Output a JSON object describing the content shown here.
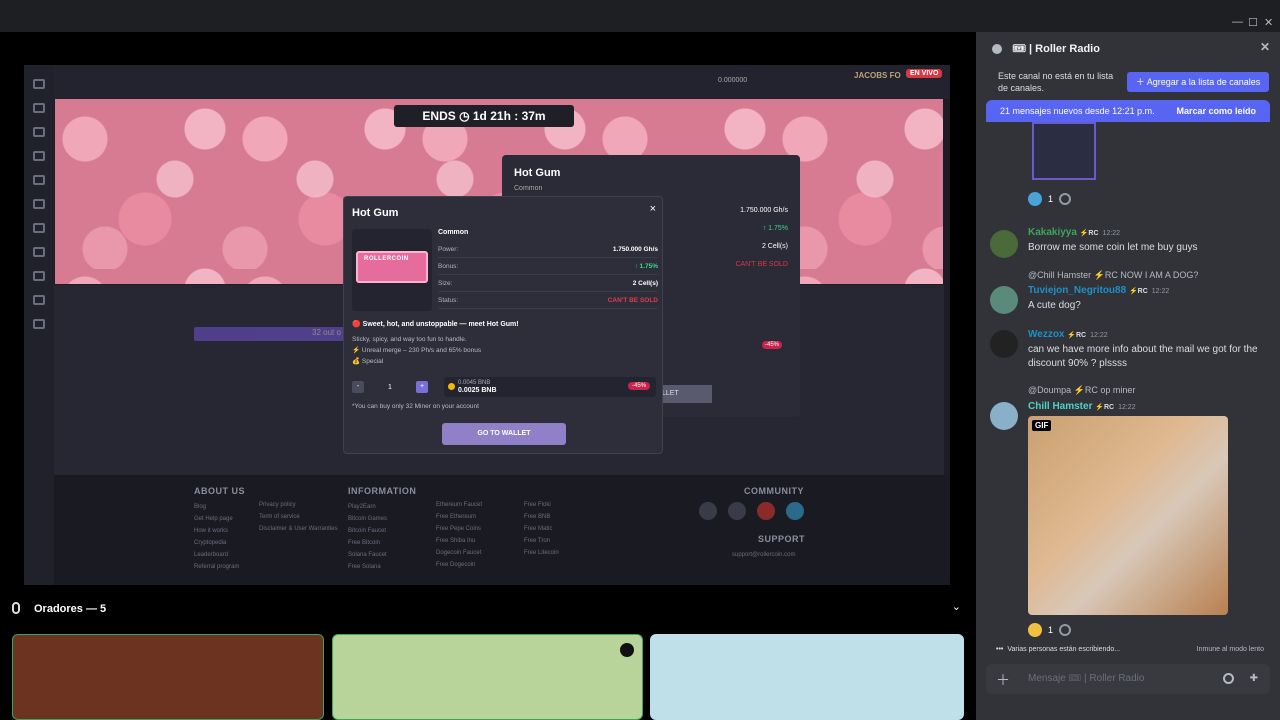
{
  "stream": {
    "ends_label": "ENDS ◷ 1d 21h : 37m",
    "balance": "0.000000",
    "username": "JACOBS FO",
    "live_badge": "EN VIVO",
    "bg_panel_title": "Hot Gum",
    "bg_panel_common": "Common",
    "bg_power": "1.750.000 Gh/s",
    "bg_bonus": "↑ 1.75%",
    "bg_size": "2 Cell(s)",
    "bg_status": "CAN'T BE SOLD",
    "bg_disc": "-45%",
    "bg_wallet": "LLET",
    "progress_text": "32 out o"
  },
  "modal": {
    "title": "Hot Gum",
    "close": "×",
    "rarity": "Common",
    "chip_label": "ROLLERCOIN",
    "rows": [
      {
        "label": "Power:",
        "value": "1.750.000 Gh/s"
      },
      {
        "label": "Bonus:",
        "value": "↑ 1.75%"
      },
      {
        "label": "Size:",
        "value": "2 Cell(s)"
      },
      {
        "label": "Status:",
        "value": "CAN'T BE SOLD"
      }
    ],
    "lead": "🔴 Sweet, hot, and unstoppable — meet Hot Gum!",
    "line1": "Sticky, spicy, and way too fun to handle.",
    "line2": "⚡ Unreal merge – 230 Ph/s and 65% bonus",
    "line3": "💰 Special",
    "qty_minus": "-",
    "qty_value": "1",
    "qty_plus": "+",
    "price_old": "0.0045 BNB",
    "price_new": "0.0025 BNB",
    "discount": "-45%",
    "note": "*You can buy only 32 Miner on your account",
    "button": "GO TO WALLET"
  },
  "footer": {
    "about": {
      "head": "ABOUT US",
      "items": [
        "Blog",
        "Get Help page",
        "How it works",
        "Cryptopedia",
        "Leaderboard",
        "Referral program"
      ]
    },
    "about2": {
      "items": [
        "Privacy policy",
        "Term of service",
        "Disclaimer & User Warranties"
      ]
    },
    "info": {
      "head": "INFORMATION",
      "items": [
        "Play2Earn",
        "Bitcoin Games",
        "Bitcoin Faucet",
        "Free Bitcoin",
        "Solana Faucet",
        "Free Solana"
      ]
    },
    "info2": {
      "items": [
        "Ethereum Faucet",
        "Free Ethereum",
        "Free Pepe Coins",
        "Free Shiba Inu",
        "Dogecoin Faucet",
        "Free Dogecoin"
      ]
    },
    "info3": {
      "items": [
        "Free Floki",
        "Free BNB",
        "Free Matic",
        "Free Tron",
        "Free Litecoin"
      ]
    },
    "community": "COMMUNITY",
    "support": "SUPPORT",
    "support_email": "support@rollercoin.com"
  },
  "speakers": {
    "label": "Oradores — 5"
  },
  "chat": {
    "channel": "🎟 | Roller Radio",
    "not_in_list": "Este canal no está en tu lista de canales.",
    "add_button": "＋ Agregar a la lista de canales",
    "new_messages": "21 mensajes nuevos desde 12:21 p.m.",
    "mark_read": "Marcar como leído",
    "messages": [
      {
        "user": "Kakakiyya",
        "tag": "⚡RC",
        "time": "12:22",
        "text": "Borrow me some coin let me buy guys",
        "color": "#3ba55d"
      },
      {
        "reply": "@Chill Hamster ⚡RC NOW I AM A DOG?",
        "user": "Tuviejon_Negritou88",
        "tag": "⚡RC",
        "time": "12:22",
        "text": "A cute dog?",
        "color": "#1e90c8"
      },
      {
        "user": "Wezzox",
        "tag": "⚡RC",
        "time": "12:22",
        "text": "can we have more info about the mail we got  for the discount 90% ? plssss",
        "color": "#1e90c8"
      },
      {
        "reply": "@Doumpa ⚡RC op miner",
        "user": "Chill Hamster",
        "tag": "⚡RC",
        "time": "12:22",
        "text": "",
        "color": "#4fd1c5"
      }
    ],
    "reaction_count_1": "1",
    "reaction_count_2": "1",
    "gif_label": "GIF",
    "typing": "Varias personas están escribiendo...",
    "slowmode": "Inmune al modo lento",
    "input_placeholder": "Mensaje 🎟 | Roller Radio"
  }
}
